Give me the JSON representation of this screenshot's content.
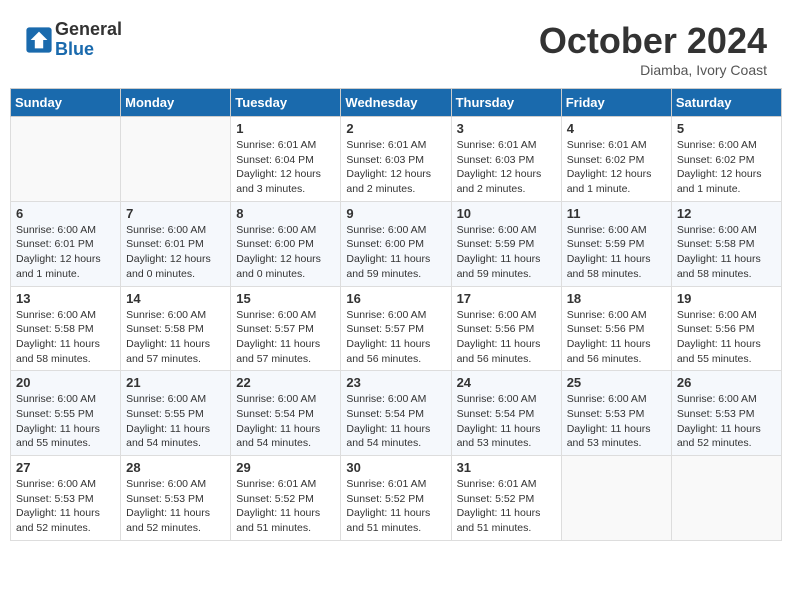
{
  "header": {
    "logo_general": "General",
    "logo_blue": "Blue",
    "title": "October 2024",
    "location": "Diamba, Ivory Coast"
  },
  "days_of_week": [
    "Sunday",
    "Monday",
    "Tuesday",
    "Wednesday",
    "Thursday",
    "Friday",
    "Saturday"
  ],
  "weeks": [
    [
      {
        "day": "",
        "info": ""
      },
      {
        "day": "",
        "info": ""
      },
      {
        "day": "1",
        "info": "Sunrise: 6:01 AM\nSunset: 6:04 PM\nDaylight: 12 hours and 3 minutes."
      },
      {
        "day": "2",
        "info": "Sunrise: 6:01 AM\nSunset: 6:03 PM\nDaylight: 12 hours and 2 minutes."
      },
      {
        "day": "3",
        "info": "Sunrise: 6:01 AM\nSunset: 6:03 PM\nDaylight: 12 hours and 2 minutes."
      },
      {
        "day": "4",
        "info": "Sunrise: 6:01 AM\nSunset: 6:02 PM\nDaylight: 12 hours and 1 minute."
      },
      {
        "day": "5",
        "info": "Sunrise: 6:00 AM\nSunset: 6:02 PM\nDaylight: 12 hours and 1 minute."
      }
    ],
    [
      {
        "day": "6",
        "info": "Sunrise: 6:00 AM\nSunset: 6:01 PM\nDaylight: 12 hours and 1 minute."
      },
      {
        "day": "7",
        "info": "Sunrise: 6:00 AM\nSunset: 6:01 PM\nDaylight: 12 hours and 0 minutes."
      },
      {
        "day": "8",
        "info": "Sunrise: 6:00 AM\nSunset: 6:00 PM\nDaylight: 12 hours and 0 minutes."
      },
      {
        "day": "9",
        "info": "Sunrise: 6:00 AM\nSunset: 6:00 PM\nDaylight: 11 hours and 59 minutes."
      },
      {
        "day": "10",
        "info": "Sunrise: 6:00 AM\nSunset: 5:59 PM\nDaylight: 11 hours and 59 minutes."
      },
      {
        "day": "11",
        "info": "Sunrise: 6:00 AM\nSunset: 5:59 PM\nDaylight: 11 hours and 58 minutes."
      },
      {
        "day": "12",
        "info": "Sunrise: 6:00 AM\nSunset: 5:58 PM\nDaylight: 11 hours and 58 minutes."
      }
    ],
    [
      {
        "day": "13",
        "info": "Sunrise: 6:00 AM\nSunset: 5:58 PM\nDaylight: 11 hours and 58 minutes."
      },
      {
        "day": "14",
        "info": "Sunrise: 6:00 AM\nSunset: 5:58 PM\nDaylight: 11 hours and 57 minutes."
      },
      {
        "day": "15",
        "info": "Sunrise: 6:00 AM\nSunset: 5:57 PM\nDaylight: 11 hours and 57 minutes."
      },
      {
        "day": "16",
        "info": "Sunrise: 6:00 AM\nSunset: 5:57 PM\nDaylight: 11 hours and 56 minutes."
      },
      {
        "day": "17",
        "info": "Sunrise: 6:00 AM\nSunset: 5:56 PM\nDaylight: 11 hours and 56 minutes."
      },
      {
        "day": "18",
        "info": "Sunrise: 6:00 AM\nSunset: 5:56 PM\nDaylight: 11 hours and 56 minutes."
      },
      {
        "day": "19",
        "info": "Sunrise: 6:00 AM\nSunset: 5:56 PM\nDaylight: 11 hours and 55 minutes."
      }
    ],
    [
      {
        "day": "20",
        "info": "Sunrise: 6:00 AM\nSunset: 5:55 PM\nDaylight: 11 hours and 55 minutes."
      },
      {
        "day": "21",
        "info": "Sunrise: 6:00 AM\nSunset: 5:55 PM\nDaylight: 11 hours and 54 minutes."
      },
      {
        "day": "22",
        "info": "Sunrise: 6:00 AM\nSunset: 5:54 PM\nDaylight: 11 hours and 54 minutes."
      },
      {
        "day": "23",
        "info": "Sunrise: 6:00 AM\nSunset: 5:54 PM\nDaylight: 11 hours and 54 minutes."
      },
      {
        "day": "24",
        "info": "Sunrise: 6:00 AM\nSunset: 5:54 PM\nDaylight: 11 hours and 53 minutes."
      },
      {
        "day": "25",
        "info": "Sunrise: 6:00 AM\nSunset: 5:53 PM\nDaylight: 11 hours and 53 minutes."
      },
      {
        "day": "26",
        "info": "Sunrise: 6:00 AM\nSunset: 5:53 PM\nDaylight: 11 hours and 52 minutes."
      }
    ],
    [
      {
        "day": "27",
        "info": "Sunrise: 6:00 AM\nSunset: 5:53 PM\nDaylight: 11 hours and 52 minutes."
      },
      {
        "day": "28",
        "info": "Sunrise: 6:00 AM\nSunset: 5:53 PM\nDaylight: 11 hours and 52 minutes."
      },
      {
        "day": "29",
        "info": "Sunrise: 6:01 AM\nSunset: 5:52 PM\nDaylight: 11 hours and 51 minutes."
      },
      {
        "day": "30",
        "info": "Sunrise: 6:01 AM\nSunset: 5:52 PM\nDaylight: 11 hours and 51 minutes."
      },
      {
        "day": "31",
        "info": "Sunrise: 6:01 AM\nSunset: 5:52 PM\nDaylight: 11 hours and 51 minutes."
      },
      {
        "day": "",
        "info": ""
      },
      {
        "day": "",
        "info": ""
      }
    ]
  ]
}
